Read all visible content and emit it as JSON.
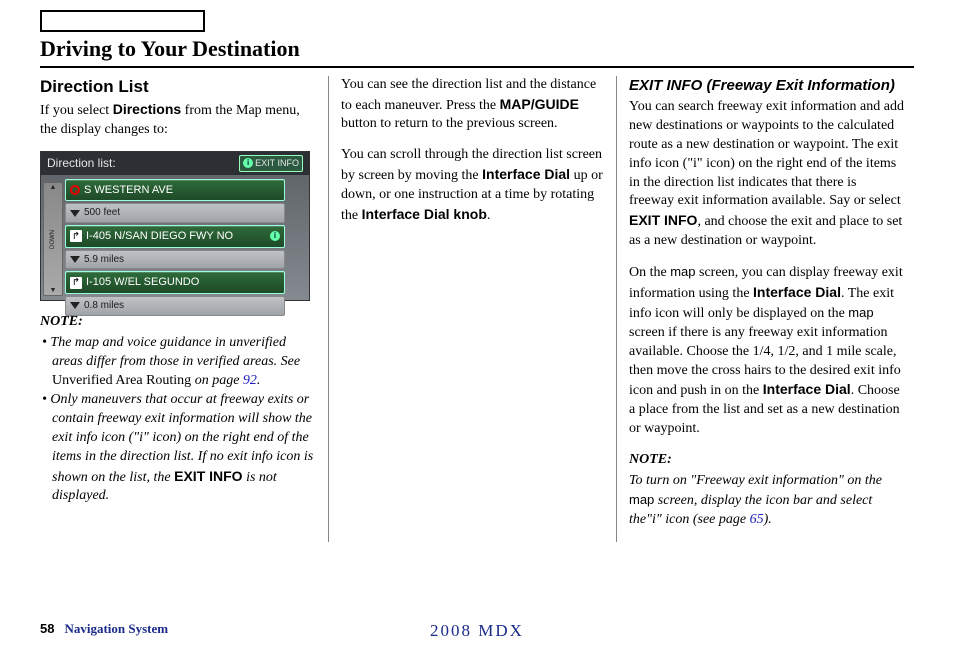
{
  "page_title": "Driving to Your Destination",
  "col1": {
    "heading": "Direction List",
    "intro_pre": "If you select ",
    "intro_bold": "Directions",
    "intro_post": " from the Map menu, the display changes to:",
    "screenshot": {
      "header": "Direction list:",
      "exit_info": "EXIT INFO",
      "row1": "S WESTERN AVE",
      "dist1": "500 feet",
      "row2": "I-405 N/SAN DIEGO FWY NO",
      "dist2": "5.9 miles",
      "row3": "I-105 W/EL SEGUNDO",
      "dist3": "0.8 miles",
      "down": "DOWN"
    },
    "note_label": "NOTE:",
    "bullet1_a": "The map and voice guidance in unverified areas differ from those in verified areas. See ",
    "bullet1_b": "Unverified Area Routing",
    "bullet1_c": " on page ",
    "bullet1_page": "92",
    "bullet1_d": ".",
    "bullet2_a": "Only maneuvers that occur at freeway exits or contain freeway exit information will show the exit info icon (\"i\" icon) on the right end of the items in the direction list. If no exit info icon is shown on the list, the ",
    "bullet2_bold": "EXIT INFO",
    "bullet2_b": " is not displayed."
  },
  "col2": {
    "p1_a": "You can see the direction list and the distance to each maneuver. Press the ",
    "p1_bold": "MAP/GUIDE",
    "p1_b": " button to return to the previous screen.",
    "p2_a": "You can scroll through the direction list screen by screen by moving the ",
    "p2_bold1": "Interface Dial",
    "p2_b": " up or down, or one instruction at a time by rotating the ",
    "p2_bold2": "Interface Dial knob",
    "p2_c": "."
  },
  "col3": {
    "heading": "EXIT INFO (Freeway Exit Information)",
    "p1_a": "You can search freeway exit information and add new destinations or waypoints to the calculated route as a new destination or waypoint. The exit info icon (\"i\" icon) on the right end of the items in the direction list indicates that there is freeway exit information available. Say or select ",
    "p1_bold": "EXIT INFO",
    "p1_b": ", and choose the exit and place to set as a new destination or waypoint.",
    "p2_a": "On the ",
    "p2_mono1": "map",
    "p2_b": " screen, you can display freeway exit information using the ",
    "p2_bold1": "Interface Dial",
    "p2_c": ". The exit info icon will only be displayed on the ",
    "p2_mono2": "map",
    "p2_d": " screen if there is any freeway exit information available. Choose the 1/4, 1/2, and 1 mile scale, then move the cross hairs to the desired exit info icon and push in on the ",
    "p2_bold2": "Interface Dial",
    "p2_e": ". Choose a place from the list and set as a new destination or waypoint.",
    "note_label": "NOTE:",
    "note_a": "To turn on \"Freeway exit information\" on the ",
    "note_mono": "map",
    "note_b": " screen, display the icon bar and select the\"i\" icon (see page ",
    "note_page": "65",
    "note_c": ")."
  },
  "footer": {
    "page": "58",
    "label": "Navigation System",
    "center": "2008 MDX"
  }
}
